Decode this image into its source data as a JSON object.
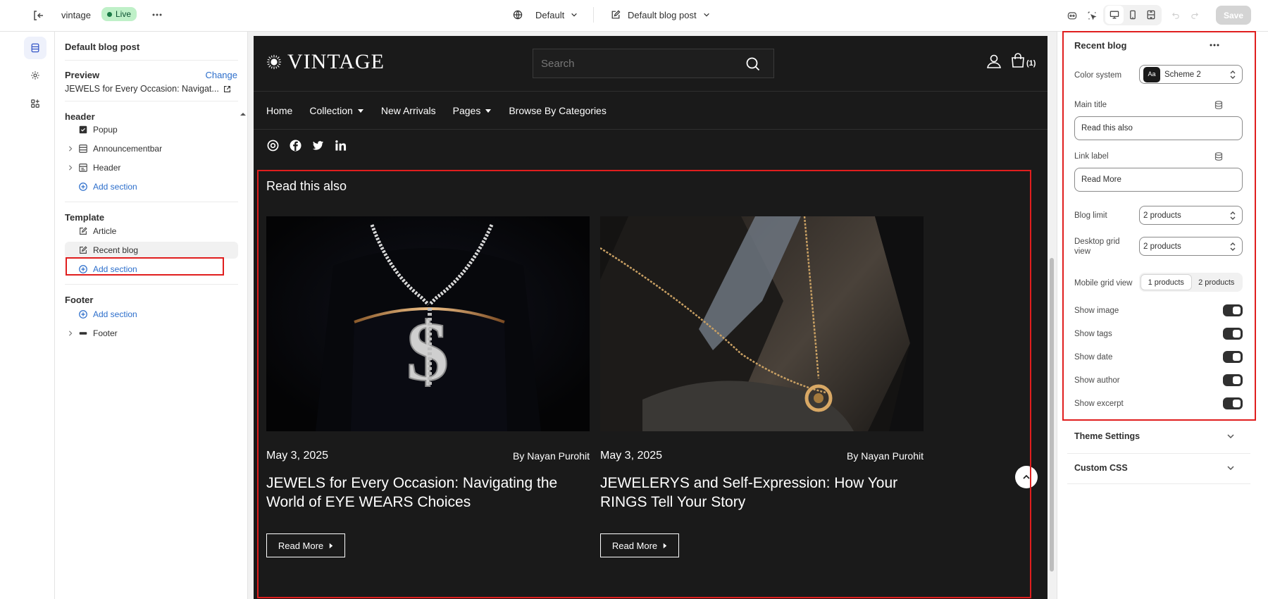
{
  "topbar": {
    "store_name": "vintage",
    "live_badge": "Live",
    "theme": "Default",
    "page": "Default blog post",
    "save_label": "Save"
  },
  "sidebar": {
    "title": "Default blog post",
    "preview_label": "Preview",
    "change_label": "Change",
    "preview_value": "JEWELS for Every Occasion: Navigat...",
    "groups": {
      "header": {
        "title": "header",
        "items": [
          "Popup",
          "Announcementbar",
          "Header"
        ],
        "add": "Add section"
      },
      "template": {
        "title": "Template",
        "items": [
          "Article",
          "Recent blog"
        ],
        "add": "Add section"
      },
      "footer": {
        "title": "Footer",
        "add": "Add section",
        "items": [
          "Footer"
        ]
      }
    }
  },
  "store": {
    "logo": "VINTAGE",
    "search_placeholder": "Search",
    "cart_count": "(1)",
    "nav": [
      "Home",
      "Collection",
      "New Arrivals",
      "Pages",
      "Browse By Categories"
    ],
    "section_title": "Read this also",
    "cards": [
      {
        "date": "May 3, 2025",
        "author": "By Nayan Purohit",
        "title": "JEWELS for Every Occasion: Navigating the World of EYE WEARS Choices",
        "button": "Read More"
      },
      {
        "date": "May 3, 2025",
        "author": "By Nayan Purohit",
        "title": "JEWELERYS and Self-Expression: How Your RINGS Tell Your Story",
        "button": "Read More"
      }
    ]
  },
  "settings": {
    "title": "Recent blog",
    "color_system_label": "Color system",
    "color_system_value": "Scheme 2",
    "color_system_swatch": "Aa",
    "main_title_label": "Main title",
    "main_title_value": "Read this also",
    "link_label_label": "Link label",
    "link_label_value": "Read More",
    "blog_limit_label": "Blog limit",
    "blog_limit_value": "2 products",
    "desktop_grid_label": "Desktop grid view",
    "desktop_grid_value": "2 products",
    "mobile_grid_label": "Mobile grid view",
    "mobile_grid_options": [
      "1 products",
      "2 products"
    ],
    "toggles": [
      {
        "label": "Show image",
        "on": true
      },
      {
        "label": "Show tags",
        "on": true
      },
      {
        "label": "Show date",
        "on": true
      },
      {
        "label": "Show author",
        "on": true
      },
      {
        "label": "Show excerpt",
        "on": true
      }
    ],
    "accordions": [
      "Theme Settings",
      "Custom CSS"
    ]
  },
  "colors": {
    "live_bg": "#bff0c8",
    "accent_link": "#2c6ecb",
    "highlight": "#e01e1e",
    "store_bg": "#1a1a1a"
  }
}
